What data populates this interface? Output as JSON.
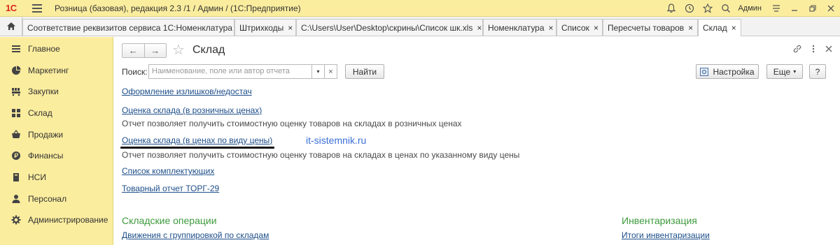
{
  "titlebar": {
    "logo": "1С",
    "title": "Розница (базовая), редакция 2.3 /1 / Админ /  (1С:Предприятие)",
    "user": "Админ"
  },
  "tabs": [
    {
      "label": "Соответствие реквизитов сервиса 1С:Номенклатура",
      "close": "×"
    },
    {
      "label": "Штрихкоды",
      "close": "×"
    },
    {
      "label": "C:\\Users\\User\\Desktop\\скрины\\Список шк.xls",
      "close": "×"
    },
    {
      "label": "Номенклатура",
      "close": "×"
    },
    {
      "label": "Список",
      "close": "×"
    },
    {
      "label": "Пересчеты товаров",
      "close": "×"
    },
    {
      "label": "Склад",
      "close": "×"
    }
  ],
  "sidebar": {
    "items": [
      {
        "label": "Главное",
        "icon": "list-icon"
      },
      {
        "label": "Маркетинг",
        "icon": "pie-chart-icon"
      },
      {
        "label": "Закупки",
        "icon": "cart-icon"
      },
      {
        "label": "Склад",
        "icon": "grid-icon"
      },
      {
        "label": "Продажи",
        "icon": "basket-icon"
      },
      {
        "label": "Финансы",
        "icon": "coin-icon"
      },
      {
        "label": "НСИ",
        "icon": "book-icon"
      },
      {
        "label": "Персонал",
        "icon": "person-icon"
      },
      {
        "label": "Администрирование",
        "icon": "gear-icon"
      }
    ]
  },
  "main": {
    "title": "Склад",
    "search_label": "Поиск:",
    "search_placeholder": "Наименование, поле или автор отчета",
    "find_button": "Найти",
    "settings_button": "Настройка",
    "more_button": "Еще",
    "help_button": "?",
    "reports": [
      {
        "link": "Оформление излишков/недостач",
        "desc": ""
      },
      {
        "link": "Оценка склада (в розничных ценах)",
        "desc": "Отчет позволяет получить стоимостную оценку товаров на складах в розничных ценах"
      },
      {
        "link": "Оценка склада (в ценах по виду цены)",
        "desc": "Отчет позволяет получить стоимостную оценку товаров на складах в ценах по указанному виду цены"
      },
      {
        "link": "Список комплектующих",
        "desc": ""
      },
      {
        "link": "Товарный отчет ТОРГ-29",
        "desc": ""
      }
    ],
    "watermark": "it-sistemnik.ru",
    "sections": [
      {
        "title": "Складские операции",
        "first_link": "Движения с группировкой по складам"
      },
      {
        "title": "Инвентаризация",
        "first_link": "Итоги инвентаризации"
      }
    ]
  },
  "colors": {
    "accent_yellow": "#fbed9e",
    "link_blue": "#1d4e89",
    "section_green": "#3d9a3d",
    "logo_red": "#d8261d"
  }
}
